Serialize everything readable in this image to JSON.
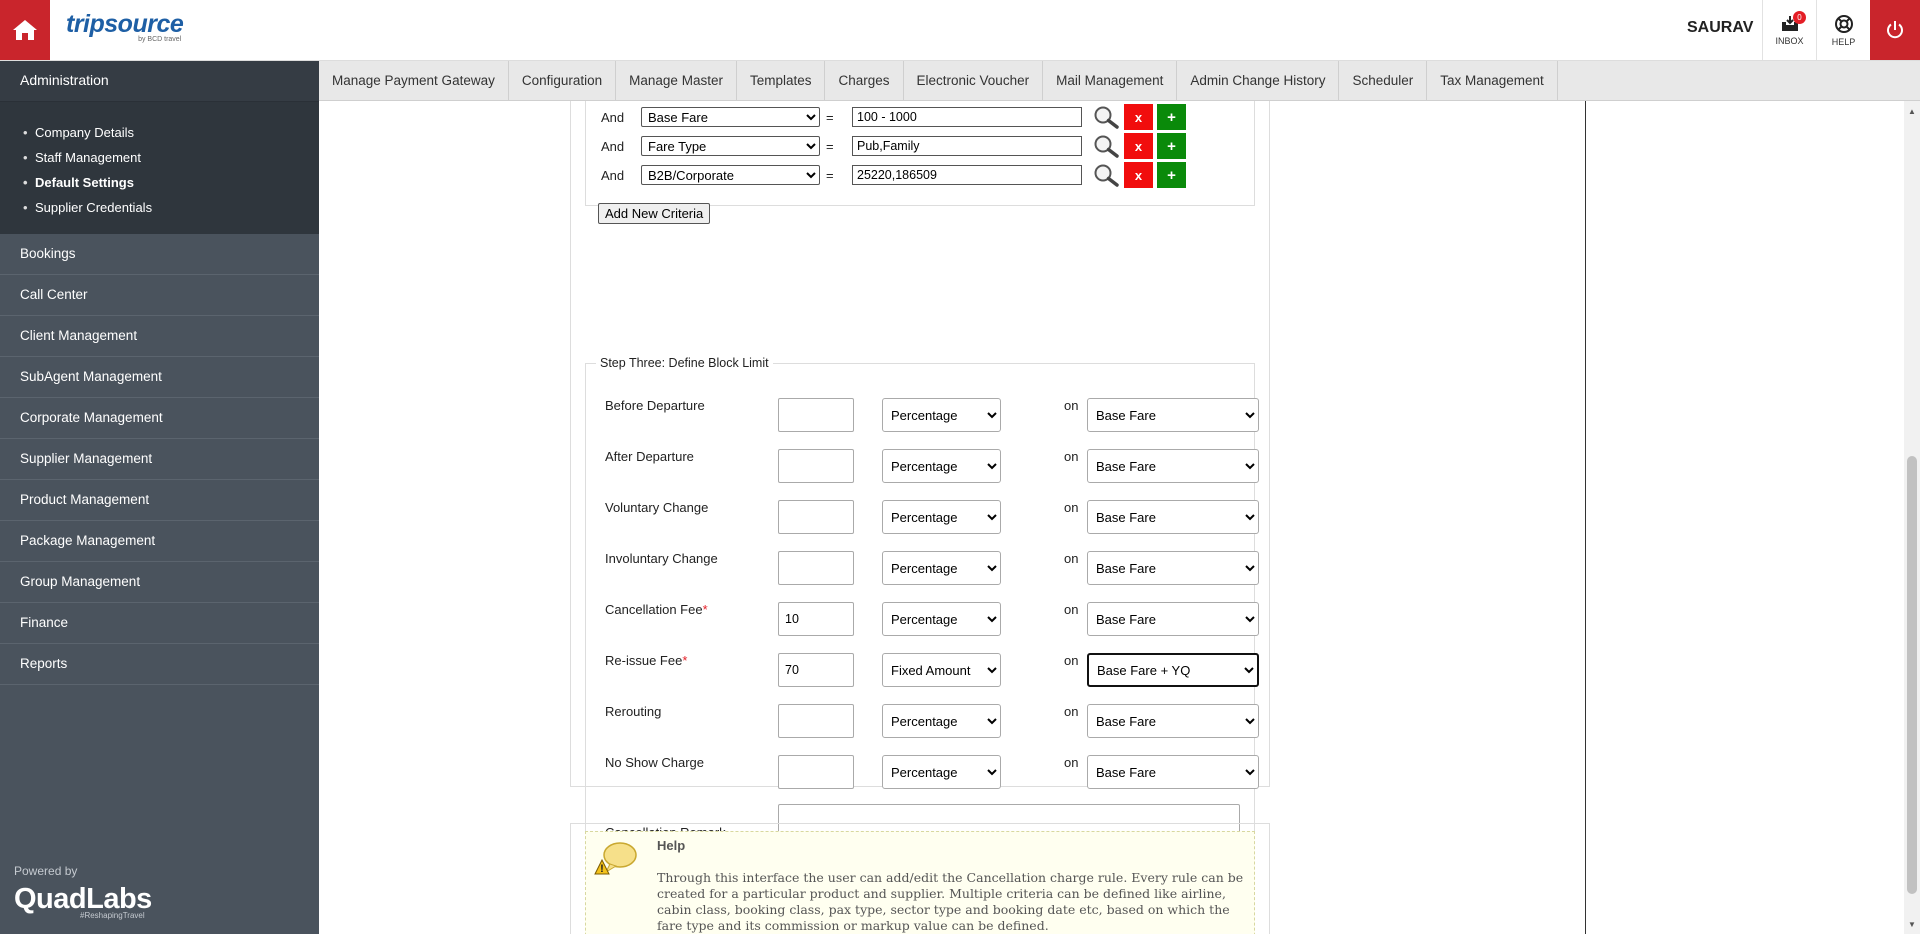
{
  "header": {
    "logo_main": "tripsource",
    "logo_sub": "by BCD travel",
    "user_name": "SAURAV",
    "inbox_label": "INBOX",
    "inbox_count": "0",
    "help_label": "HELP"
  },
  "sidebar": {
    "section_title": "Administration",
    "sub_items": [
      {
        "label": "Company Details"
      },
      {
        "label": "Staff Management"
      },
      {
        "label": "Default Settings"
      },
      {
        "label": "Supplier Credentials"
      }
    ],
    "items": [
      {
        "label": "Bookings"
      },
      {
        "label": "Call Center"
      },
      {
        "label": "Client Management"
      },
      {
        "label": "SubAgent Management"
      },
      {
        "label": "Corporate Management"
      },
      {
        "label": "Supplier Management"
      },
      {
        "label": "Product Management"
      },
      {
        "label": "Package Management"
      },
      {
        "label": "Group Management"
      },
      {
        "label": "Finance"
      },
      {
        "label": "Reports"
      }
    ],
    "powered_by": "Powered by",
    "powered_logo": "QuadLabs",
    "powered_tag": "#ReshapingTravel"
  },
  "topnav": {
    "tabs": [
      {
        "label": "Manage Payment Gateway"
      },
      {
        "label": "Configuration"
      },
      {
        "label": "Manage Master"
      },
      {
        "label": "Templates"
      },
      {
        "label": "Charges"
      },
      {
        "label": "Electronic Voucher"
      },
      {
        "label": "Mail Management"
      },
      {
        "label": "Admin Change History"
      },
      {
        "label": "Scheduler"
      },
      {
        "label": "Tax Management"
      }
    ]
  },
  "criteria": {
    "rows": [
      {
        "conj": "And",
        "field": "Base Fare",
        "op": "=",
        "value": "100 - 1000"
      },
      {
        "conj": "And",
        "field": "Fare Type",
        "op": "=",
        "value": "Pub,Family"
      },
      {
        "conj": "And",
        "field": "B2B/Corporate",
        "op": "=",
        "value": "25220,186509"
      }
    ],
    "remove_label": "x",
    "add_label": "+",
    "add_new_label": "Add New Criteria"
  },
  "block_limit": {
    "legend": "Step Three: Define Block Limit",
    "on_label": "on",
    "rows": [
      {
        "label": "Before Departure",
        "required": "",
        "value": "",
        "type": "Percentage",
        "base": "Base Fare"
      },
      {
        "label": "After Departure",
        "required": "",
        "value": "",
        "type": "Percentage",
        "base": "Base Fare"
      },
      {
        "label": "Voluntary Change",
        "required": "",
        "value": "",
        "type": "Percentage",
        "base": "Base Fare"
      },
      {
        "label": "Involuntary Change",
        "required": "",
        "value": "",
        "type": "Percentage",
        "base": "Base Fare"
      },
      {
        "label": "Cancellation Fee",
        "required": "*",
        "value": "10",
        "type": "Percentage",
        "base": "Base Fare"
      },
      {
        "label": "Re-issue Fee",
        "required": "*",
        "value": "70",
        "type": "Fixed Amount",
        "base": "Base Fare + YQ"
      },
      {
        "label": "Rerouting",
        "required": "",
        "value": "",
        "type": "Percentage",
        "base": "Base Fare"
      },
      {
        "label": "No Show Charge",
        "required": "",
        "value": "",
        "type": "Percentage",
        "base": "Base Fare"
      }
    ],
    "remark_label": "Cancellation Remark",
    "remark_value": ""
  },
  "help": {
    "title": "Help",
    "text": "Through this interface the user can add/edit the Cancellation charge rule. Every rule can be created for a particular product and supplier. Multiple criteria can be defined like airline, cabin class, booking class, pax type, sector type and booking date etc, based on which the fare type and its commission or markup value can be defined."
  },
  "colors": {
    "brand_red": "#c9252c",
    "sidebar_bg": "#4a535d",
    "sidebar_dark": "#353c44",
    "remove_red": "#f10d0d",
    "add_green": "#0a8a0a",
    "logo_blue": "#1e5fa5"
  },
  "icons": [
    "home-icon",
    "inbox-icon",
    "help-lifebuoy-icon",
    "power-icon",
    "magnifier-icon",
    "help-speech-icon"
  ]
}
